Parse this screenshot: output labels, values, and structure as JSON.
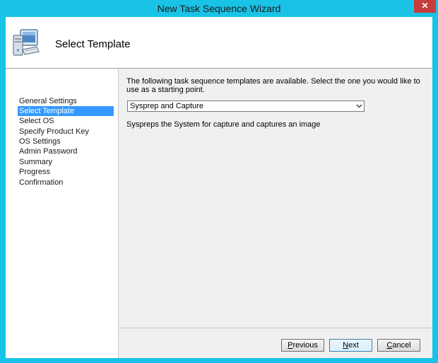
{
  "window": {
    "title": "New Task Sequence Wizard",
    "close_glyph": "✕"
  },
  "header": {
    "title": "Select Template",
    "icon": "computer-icon"
  },
  "nav": {
    "items": [
      {
        "label": "General Settings",
        "selected": false
      },
      {
        "label": "Select Template",
        "selected": true
      },
      {
        "label": "Select OS",
        "selected": false
      },
      {
        "label": "Specify Product Key",
        "selected": false
      },
      {
        "label": "OS Settings",
        "selected": false
      },
      {
        "label": "Admin Password",
        "selected": false
      },
      {
        "label": "Summary",
        "selected": false
      },
      {
        "label": "Progress",
        "selected": false
      },
      {
        "label": "Confirmation",
        "selected": false
      }
    ]
  },
  "content": {
    "instructions": "The following task sequence templates are available.  Select the one you would like to use as a starting point.",
    "template_select": {
      "value": "Sysprep and Capture"
    },
    "description": "Syspreps the System for capture and captures an image"
  },
  "buttons": {
    "previous": {
      "label": "Previous",
      "mnemonic": "P",
      "rest": "revious"
    },
    "next": {
      "label": "Next",
      "mnemonic": "N",
      "rest": "ext"
    },
    "cancel": {
      "label": "Cancel",
      "mnemonic": "C",
      "rest": "ancel"
    }
  },
  "colors": {
    "frame": "#19c3e6",
    "selection": "#3399ff",
    "close": "#c73c3c"
  }
}
